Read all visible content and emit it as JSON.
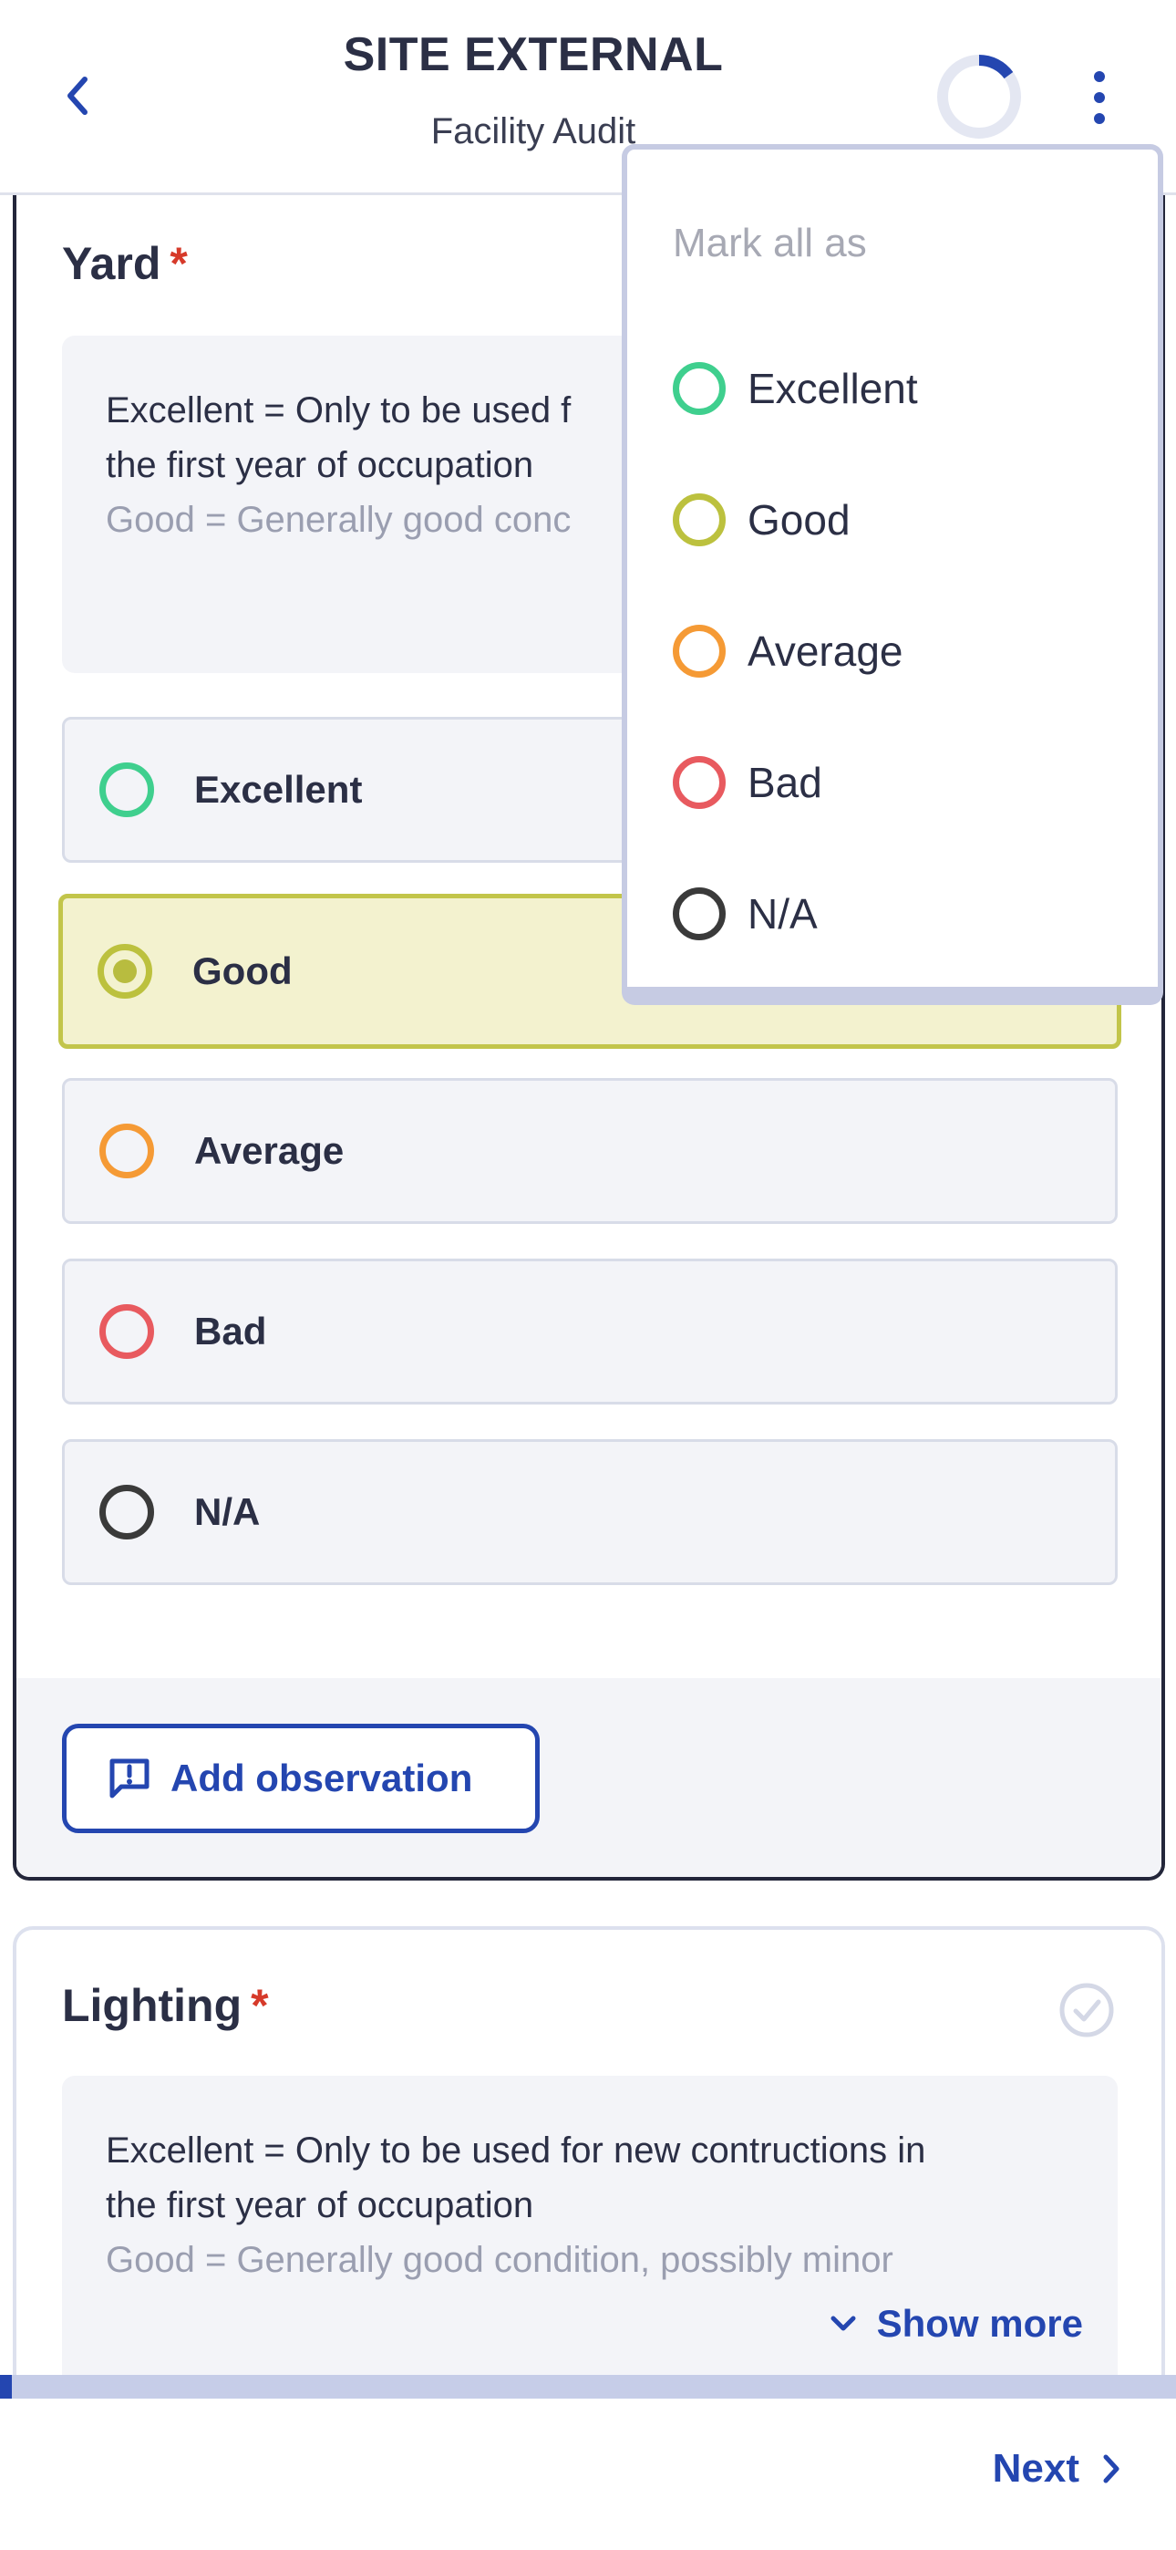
{
  "header": {
    "title": "SITE EXTERNAL",
    "subtitle": "Facility Audit",
    "progress_fraction": 0.15
  },
  "colors": {
    "accent": "#2446b0",
    "excellent": "#3fcf8e",
    "good": "#bcc13e",
    "average": "#f59a35",
    "bad": "#e85a5f",
    "na": "#3a3a3a",
    "required": "#d63a2a"
  },
  "menu": {
    "header": "Mark all as",
    "items": [
      "Excellent",
      "Good",
      "Average",
      "Bad",
      "N/A"
    ]
  },
  "yard": {
    "title": "Yard",
    "required_mark": "*",
    "description": [
      "Excellent = Only to be used f",
      "the first year of occupation",
      "Good = Generally good conc"
    ],
    "options": [
      "Excellent",
      "Good",
      "Average",
      "Bad",
      "N/A"
    ],
    "selected": "Good",
    "add_observation_label": "Add observation"
  },
  "lighting": {
    "title": "Lighting",
    "required_mark": "*",
    "description": [
      "Excellent = Only to be used for new contructions in",
      "the first year of occupation",
      "Good = Generally good condition, possibly minor"
    ],
    "show_more_label": "Show more"
  },
  "footer": {
    "next_label": "Next",
    "progress_fraction": 0.01
  },
  "icons": {
    "back": "chevron-left-icon",
    "more": "more-vertical-icon",
    "observation": "comment-alert-icon",
    "check": "check-circle-icon",
    "show_more": "chevron-down-icon",
    "next": "chevron-right-icon"
  }
}
